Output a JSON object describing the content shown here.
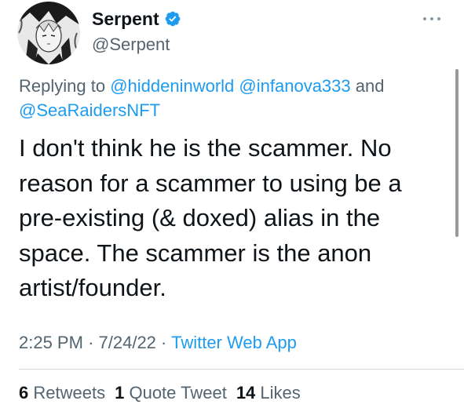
{
  "author": {
    "display_name": "Serpent",
    "handle": "@Serpent",
    "verified": true
  },
  "reply": {
    "prefix": "Replying to",
    "mentions": [
      "@hiddeninworld",
      "@infanova333",
      "@SeaRaidersNFT"
    ],
    "conjunction": "and"
  },
  "tweet": {
    "text": "I don't think he is the scammer. No\nreason for a scammer to using be a\npre-existing (& doxed) alias in the\nspace. The scammer is the anon\nartist/founder."
  },
  "meta": {
    "time": "2:25 PM",
    "separator": "·",
    "date": "7/24/22",
    "source": "Twitter Web App"
  },
  "stats": {
    "retweets_count": "6",
    "retweets_label": "Retweets",
    "quotes_count": "1",
    "quotes_label": "Quote Tweet",
    "likes_count": "14",
    "likes_label": "Likes"
  },
  "colors": {
    "link": "#1d9bf0",
    "secondary_text": "#536471",
    "primary_text": "#0f1419",
    "divider": "#cfd9de"
  },
  "icons": [
    "verified-badge-icon",
    "more-options-icon"
  ]
}
